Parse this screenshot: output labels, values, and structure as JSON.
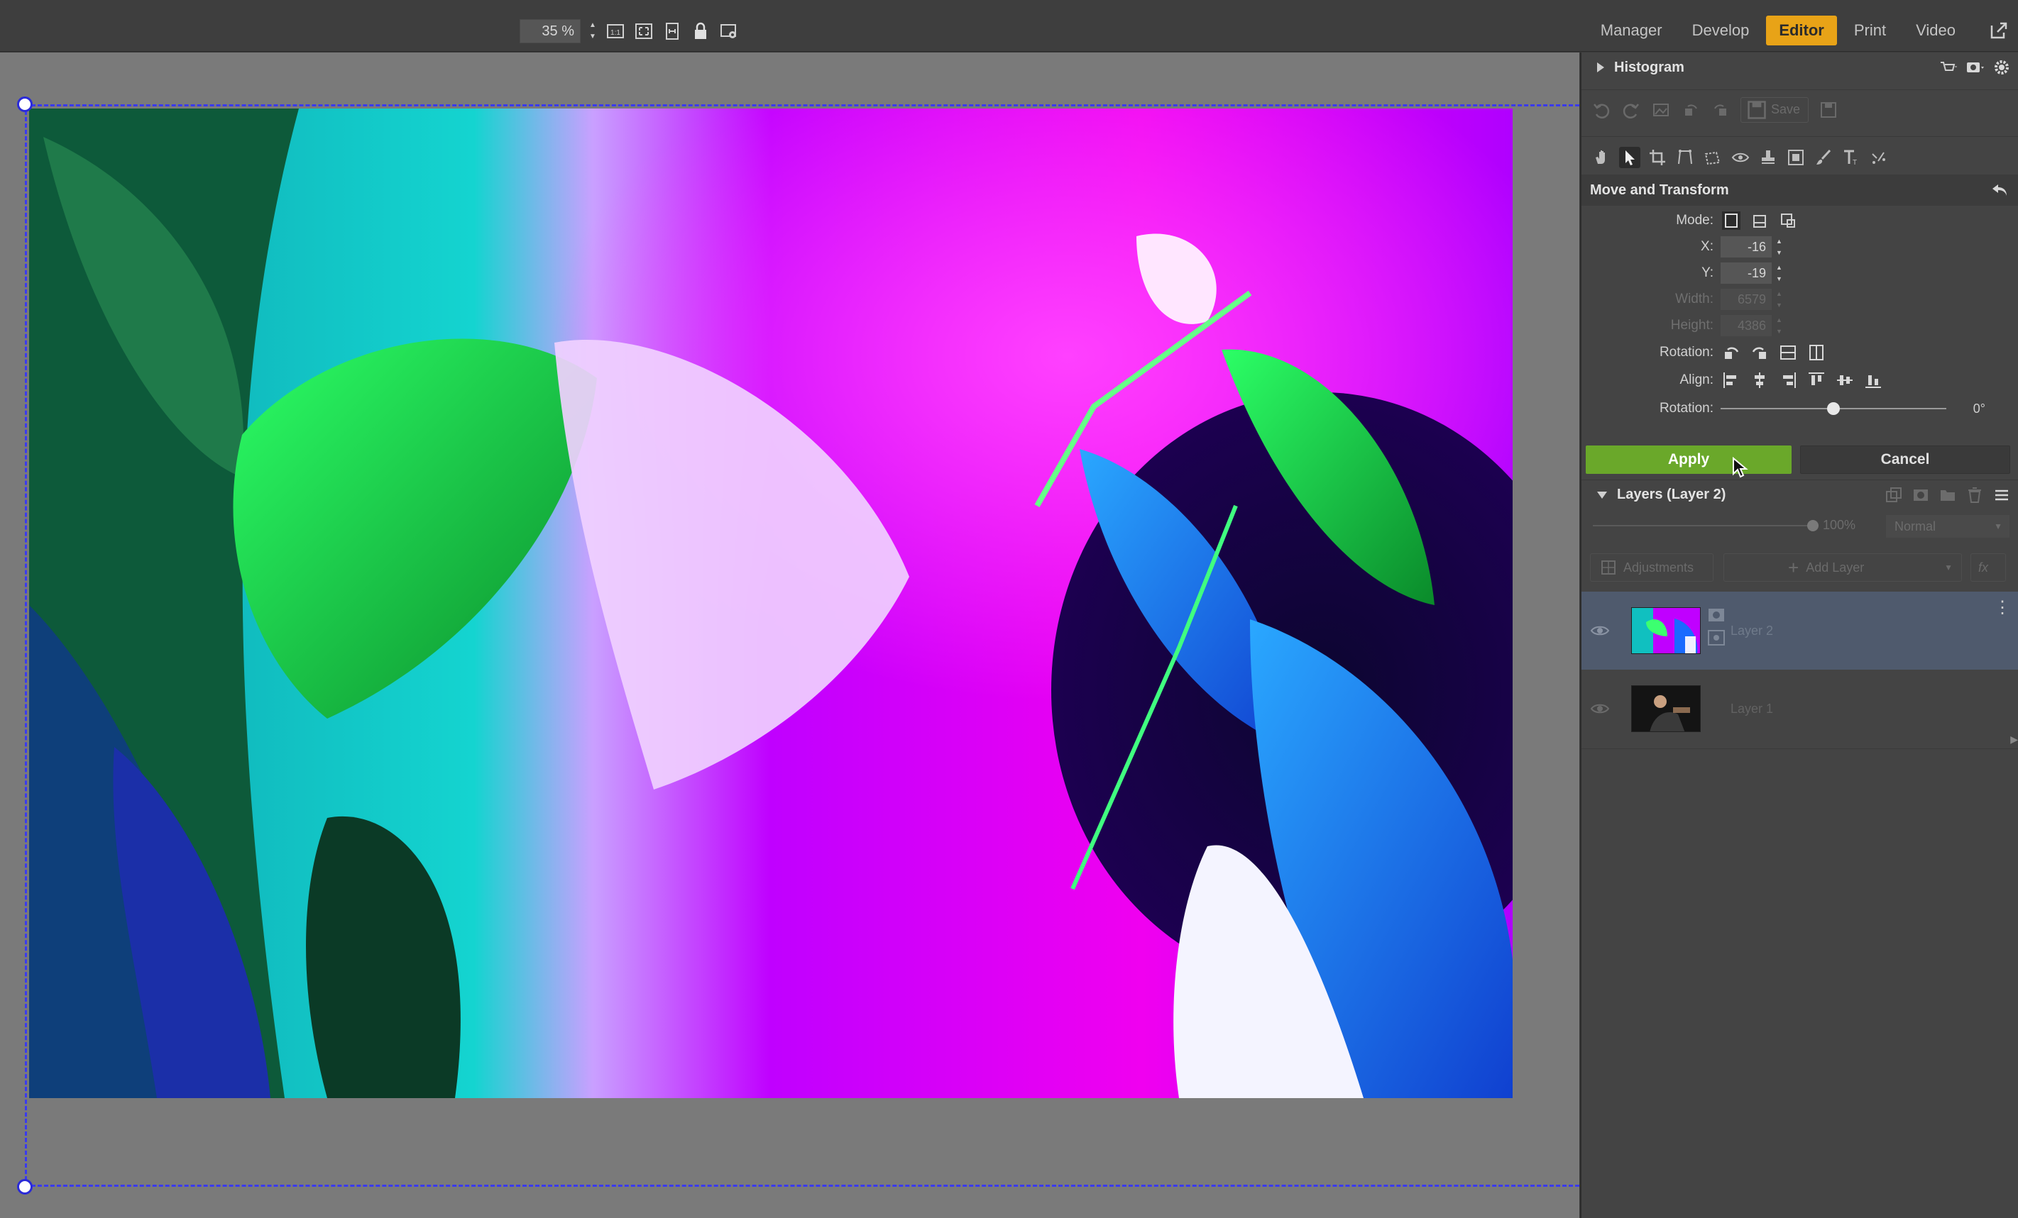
{
  "topbar": {
    "zoom": "35 %",
    "modules": [
      {
        "label": "Manager",
        "active": false
      },
      {
        "label": "Develop",
        "active": false
      },
      {
        "label": "Editor",
        "active": true
      },
      {
        "label": "Print",
        "active": false
      },
      {
        "label": "Video",
        "active": false
      }
    ],
    "toolbar_icons": [
      "actual-size-icon",
      "fit-to-screen-icon",
      "fit-width-icon",
      "lock-icon",
      "overlay-settings-icon"
    ],
    "accent_color": "#e8a317"
  },
  "panel": {
    "histogram_title": "Histogram",
    "save_label": "Save",
    "move_transform_title": "Move and Transform",
    "mode_label": "Mode:",
    "x_label": "X:",
    "x_value": "-16",
    "y_label": "Y:",
    "y_value": "-19",
    "width_label": "Width:",
    "width_value": "6579",
    "height_label": "Height:",
    "height_value": "4386",
    "rotation_label": "Rotation:",
    "align_label": "Align:",
    "rotation_slider_label": "Rotation:",
    "rotation_value": "0°",
    "rotation_level": 0.5,
    "apply_label": "Apply",
    "cancel_label": "Cancel",
    "apply_color": "#6aa82a",
    "layers_title": "Layers (Layer 2)",
    "opacity_value": "100%",
    "blend_mode": "Normal",
    "adjustments_label": "Adjustments",
    "add_layer_label": "Add Layer",
    "fx_label": "fx",
    "layers": [
      {
        "name": "Layer 2",
        "selected": true
      },
      {
        "name": "Layer 1",
        "selected": false
      }
    ]
  }
}
